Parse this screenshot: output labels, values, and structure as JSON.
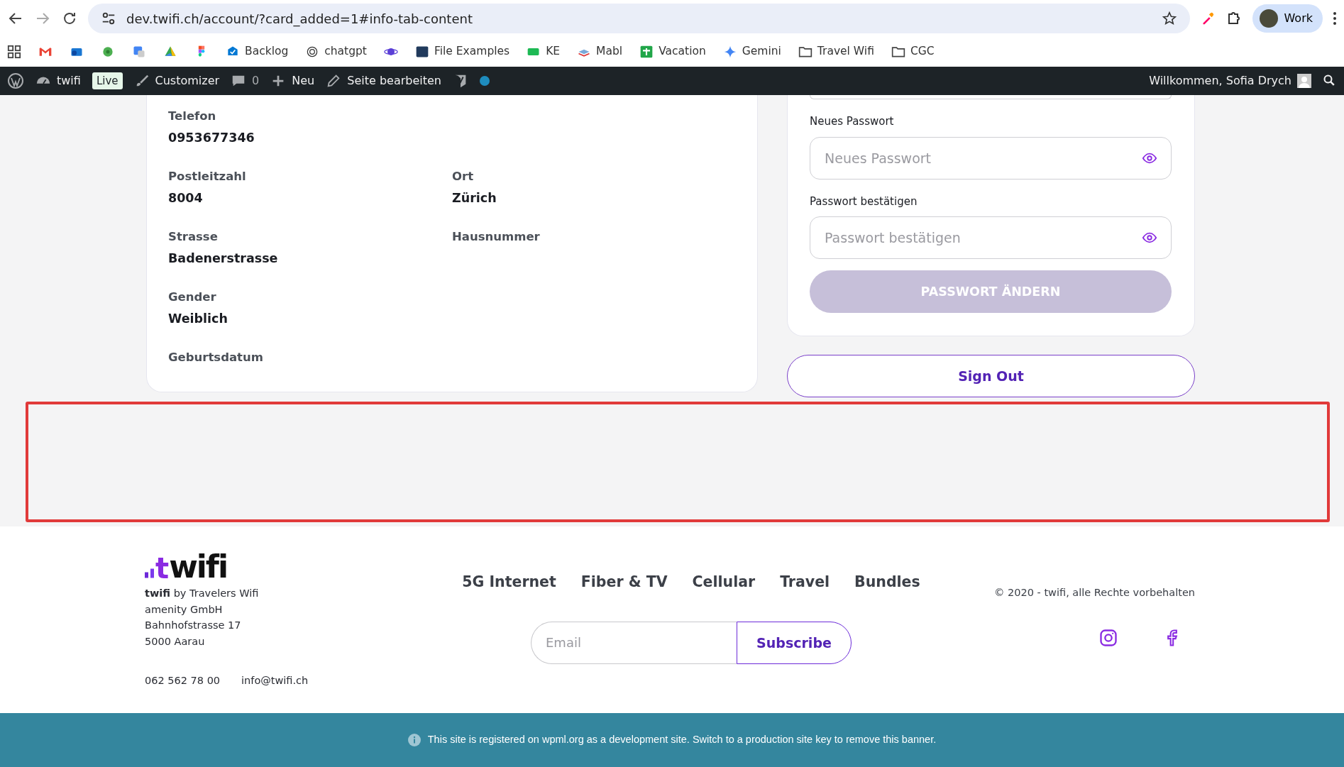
{
  "browser": {
    "url": "dev.twifi.ch/account/?card_added=1#info-tab-content",
    "profile": "Work",
    "bookmarks": [
      {
        "kind": "icon"
      },
      {
        "kind": "icon"
      },
      {
        "kind": "icon"
      },
      {
        "kind": "icon"
      },
      {
        "kind": "icon"
      },
      {
        "kind": "icon"
      },
      {
        "kind": "link",
        "label": "Backlog"
      },
      {
        "kind": "link",
        "label": "chatgpt"
      },
      {
        "kind": "icon"
      },
      {
        "kind": "link",
        "label": "File Examples"
      },
      {
        "kind": "link",
        "label": "KE"
      },
      {
        "kind": "link",
        "label": "Mabl"
      },
      {
        "kind": "link",
        "label": "Vacation"
      },
      {
        "kind": "link",
        "label": "Gemini"
      },
      {
        "kind": "folder",
        "label": "Travel Wifi"
      },
      {
        "kind": "folder",
        "label": "CGC"
      }
    ]
  },
  "admin_bar": {
    "site": "twifi",
    "badge": "Live",
    "customizer": "Customizer",
    "comments": "0",
    "new": "Neu",
    "edit": "Seite bearbeiten",
    "greeting": "Willkommen, Sofia Drych"
  },
  "profile": {
    "rows": [
      [
        {
          "label": "Telefon",
          "value": "0953677346"
        }
      ],
      [
        {
          "label": "Postleitzahl",
          "value": "8004"
        },
        {
          "label": "Ort",
          "value": "Zürich"
        }
      ],
      [
        {
          "label": "Strasse",
          "value": "Badenerstrasse"
        },
        {
          "label": "Hausnummer"
        }
      ],
      [
        {
          "label": "Gender",
          "value": "Weiblich"
        }
      ],
      [
        {
          "label": "Geburtsdatum"
        }
      ]
    ]
  },
  "password": {
    "fields": [
      {
        "label": "Neues Passwort",
        "placeholder": "Neues Passwort"
      },
      {
        "label": "Passwort bestätigen",
        "placeholder": "Passwort bestätigen"
      }
    ],
    "button": {
      "label": "PASSWORT ÄNDERN",
      "disabled": true
    }
  },
  "sign_out": "Sign Out",
  "footer": {
    "logo": {
      "mark": "t",
      "text": "wifi"
    },
    "company": [
      "**twifi** by Travelers Wifi",
      "amenity GmbH",
      "Bahnhofstrasse 17",
      "5000 Aarau"
    ],
    "phone": "062 562 78 00",
    "email": "info@twifi.ch",
    "nav": [
      "5G Internet",
      "Fiber & TV",
      "Cellular",
      "Travel",
      "Bundles"
    ],
    "newsletter": {
      "placeholder": "Email",
      "button": "Subscribe"
    },
    "copyright": "© 2020 - twifi, alle Rechte vorbehalten"
  },
  "banner": "This site is registered on wpml.org as a development site. Switch to a production site key to remove this banner."
}
